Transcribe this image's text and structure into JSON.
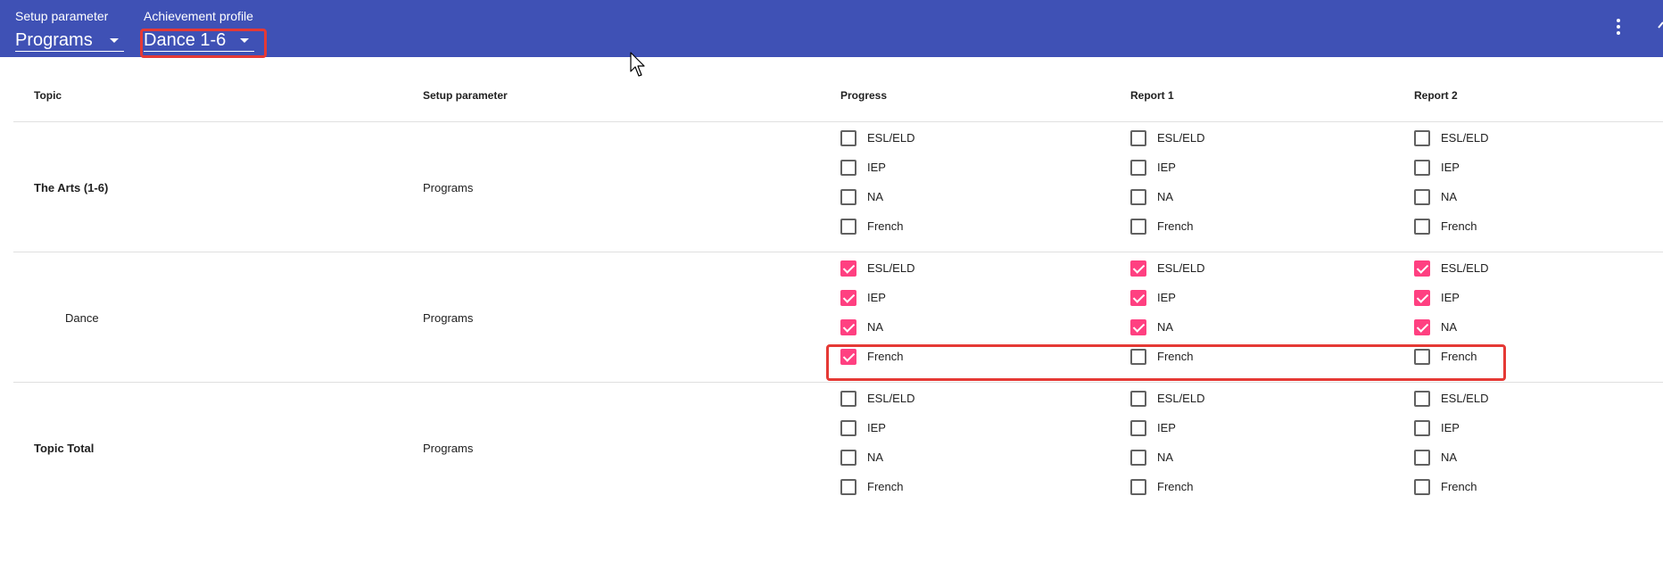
{
  "toolbar": {
    "setup_parameter": {
      "label": "Setup parameter",
      "value": "Programs"
    },
    "achievement_profile": {
      "label": "Achievement profile",
      "value": "Dance 1-6"
    },
    "more_icon": "more-vert-icon"
  },
  "table": {
    "headers": {
      "topic": "Topic",
      "setup_parameter": "Setup parameter",
      "progress": "Progress",
      "report1": "Report 1",
      "report2": "Report 2"
    },
    "options": [
      "ESL/ELD",
      "IEP",
      "NA",
      "French"
    ],
    "rows": [
      {
        "topic": "The Arts (1-6)",
        "setup": "Programs",
        "progress": [
          false,
          false,
          false,
          false
        ],
        "report1": [
          false,
          false,
          false,
          false
        ],
        "report2": [
          false,
          false,
          false,
          false
        ]
      },
      {
        "topic": "Dance",
        "setup": "Programs",
        "progress": [
          true,
          true,
          true,
          true
        ],
        "report1": [
          true,
          true,
          true,
          false
        ],
        "report2": [
          true,
          true,
          true,
          false
        ]
      },
      {
        "topic": "Topic Total",
        "setup": "Programs",
        "progress": [
          false,
          false,
          false,
          false
        ],
        "report1": [
          false,
          false,
          false,
          false
        ],
        "report2": [
          false,
          false,
          false,
          false
        ]
      }
    ]
  },
  "colors": {
    "app_bar": "#3f51b5",
    "checkbox_checked": "#ff4081",
    "highlight": "#e53935"
  }
}
